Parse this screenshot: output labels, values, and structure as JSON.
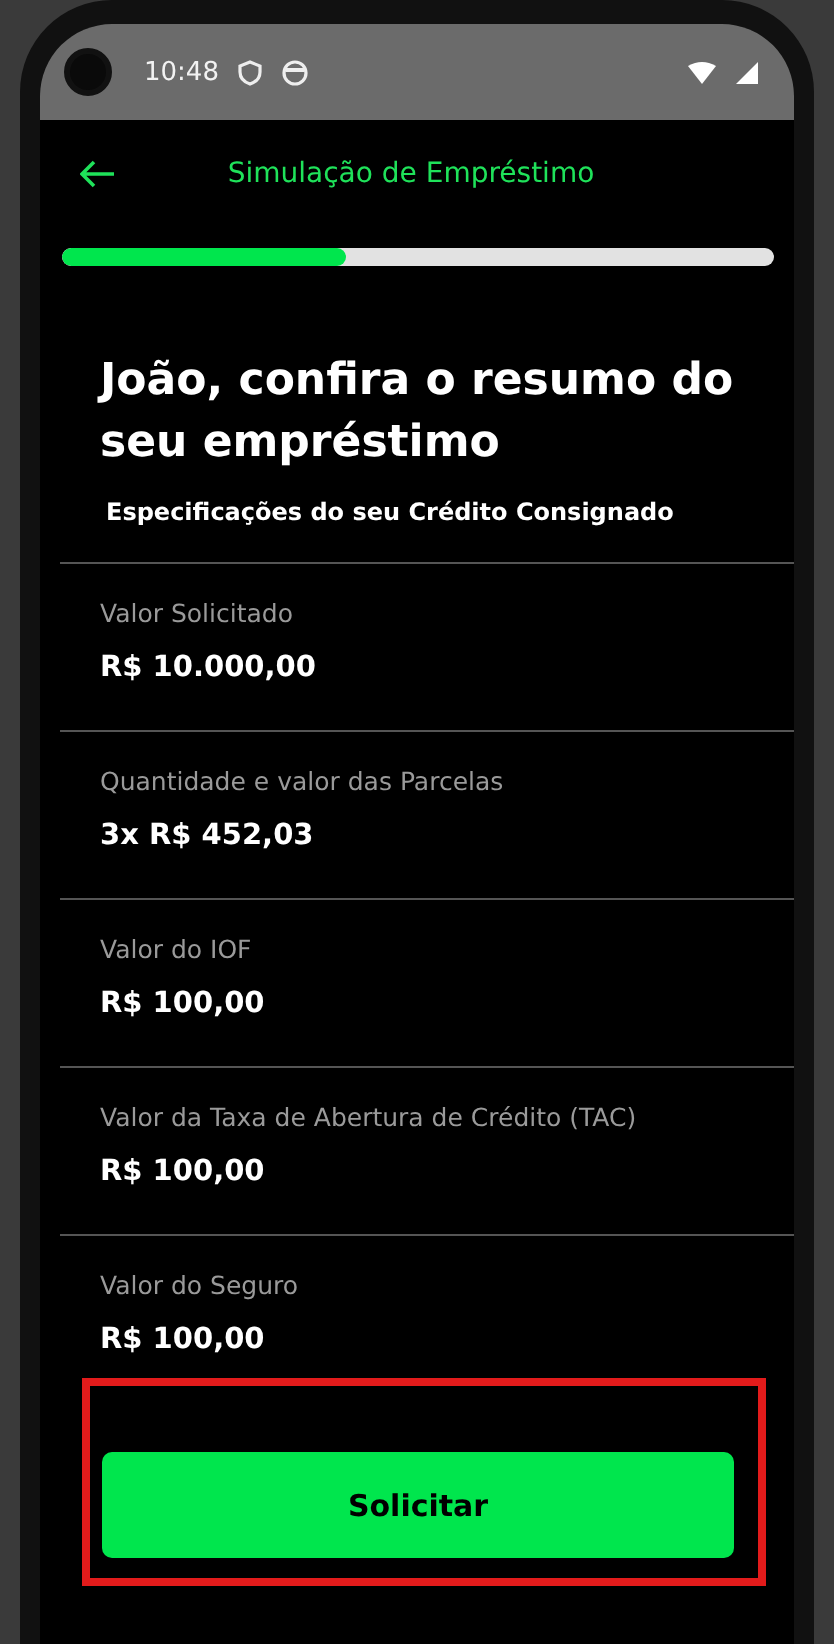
{
  "status_bar": {
    "time": "10:48"
  },
  "header": {
    "title": "Simulação de Empréstimo"
  },
  "progress": {
    "level": 0.4
  },
  "heading": "João, confira o resumo do seu empréstimo",
  "subtitle": "Especificações do seu Crédito Consignado",
  "items": [
    {
      "label": "Valor Solicitado",
      "value": "R$ 10.000,00"
    },
    {
      "label": "Quantidade e valor das Parcelas",
      "value": "3x R$ 452,03"
    },
    {
      "label": "Valor do IOF",
      "value": "R$ 100,00"
    },
    {
      "label": "Valor da Taxa de Abertura de Crédito (TAC)",
      "value": "R$ 100,00"
    },
    {
      "label": "Valor do Seguro",
      "value": "R$ 100,00"
    }
  ],
  "button": {
    "label": "Solicitar",
    "highlighted": true
  }
}
